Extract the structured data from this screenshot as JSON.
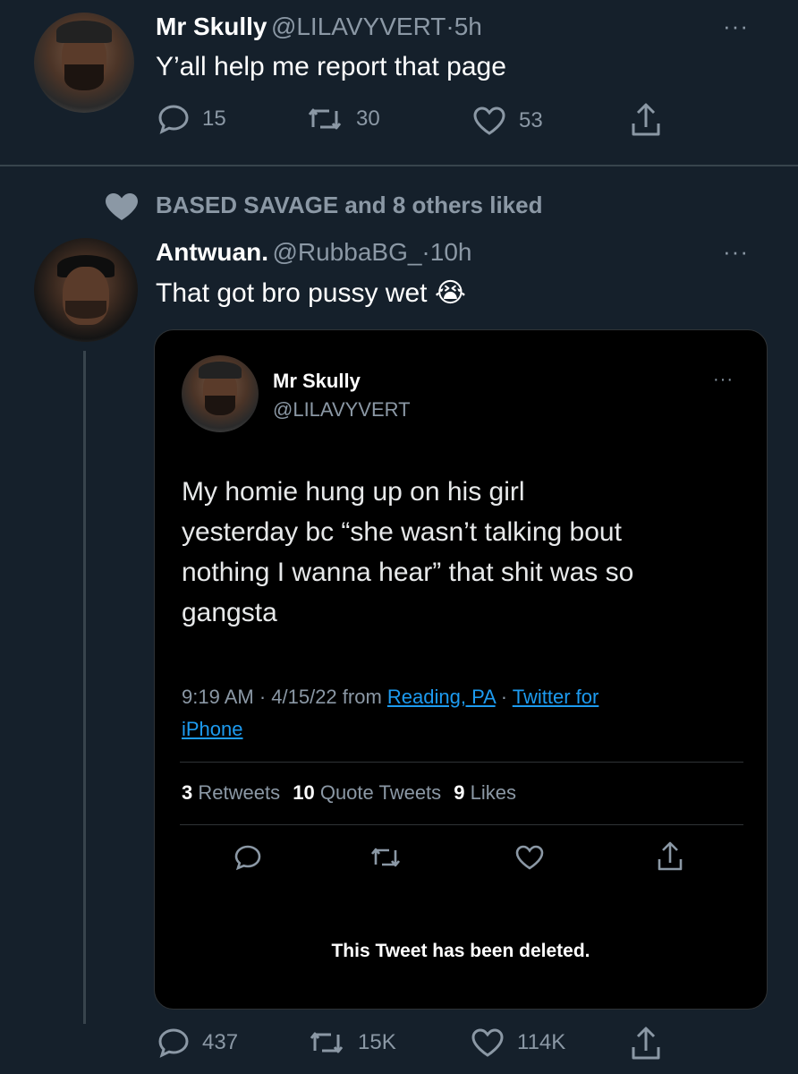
{
  "tweet1": {
    "name": "Mr Skully",
    "handle": "@LILAVYVERT",
    "separator": "·",
    "time": "5h",
    "text": "Y’all help me report that page",
    "replies": "15",
    "retweets": "30",
    "likes": "53"
  },
  "liked_banner": {
    "text": "BASED SAVAGE and 8 others liked"
  },
  "tweet2": {
    "name": "Antwuan.",
    "handle": "@RubbaBG_",
    "separator": "·",
    "time": "10h",
    "text": "That got bro pussy wet",
    "emoji": "😭",
    "replies": "437",
    "retweets": "15K",
    "likes": "114K"
  },
  "quoted": {
    "name": "Mr Skully",
    "handle": "@LILAVYVERT",
    "more": "···",
    "text_lines": [
      "My homie hung up on his girl",
      "yesterday bc “she wasn’t talking bout",
      "nothing I wanna hear” that shit was so",
      "gangsta"
    ],
    "meta_prefix": "9:19 AM · 4/15/22 from ",
    "location": "Reading, PA",
    "meta_sep": " · ",
    "source_1": "Twitter for",
    "source_2": "iPhone",
    "retweets_count": "3",
    "retweets_label": "Retweets",
    "quotes_count": "10",
    "quotes_label": "Quote Tweets",
    "likes_count": "9",
    "likes_label": "Likes",
    "deleted_notice": "This Tweet has been deleted."
  },
  "more_icon": "···",
  "colors": {
    "background": "#15202b",
    "card": "#000000",
    "muted": "#8b98a5",
    "link": "#1d9bf0",
    "divider": "#38444d"
  }
}
